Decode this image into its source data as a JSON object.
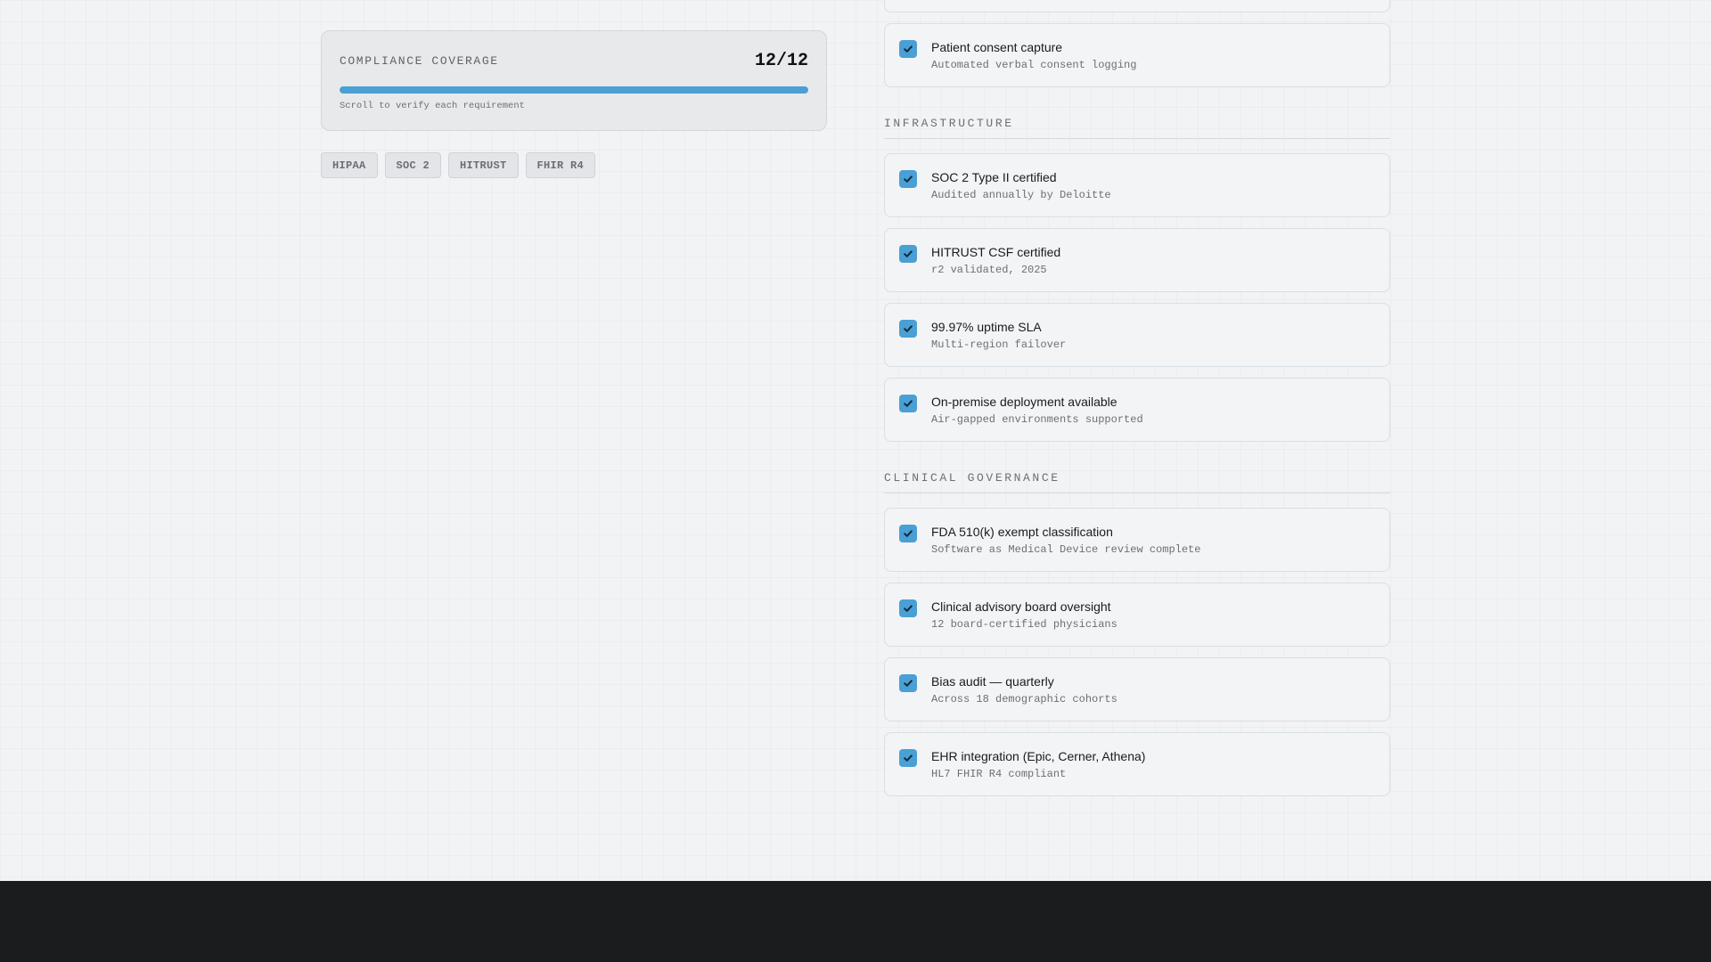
{
  "coverage": {
    "label": "COMPLIANCE COVERAGE",
    "count": "12/12",
    "progress_fraction": 1.0,
    "hint": "Scroll to verify each requirement"
  },
  "badges": [
    "HIPAA",
    "SOC 2",
    "HITRUST",
    "FHIR R4"
  ],
  "items_top": [
    {
      "title": "Patient consent capture",
      "subtitle": "Automated verbal consent logging"
    }
  ],
  "sections": [
    {
      "title": "INFRASTRUCTURE",
      "items": [
        {
          "title": "SOC 2 Type II certified",
          "subtitle": "Audited annually by Deloitte"
        },
        {
          "title": "HITRUST CSF certified",
          "subtitle": "r2 validated, 2025"
        },
        {
          "title": "99.97% uptime SLA",
          "subtitle": "Multi-region failover"
        },
        {
          "title": "On-premise deployment available",
          "subtitle": "Air-gapped environments supported"
        }
      ]
    },
    {
      "title": "CLINICAL GOVERNANCE",
      "items": [
        {
          "title": "FDA 510(k) exempt classification",
          "subtitle": "Software as Medical Device review complete"
        },
        {
          "title": "Clinical advisory board oversight",
          "subtitle": "12 board-certified physicians"
        },
        {
          "title": "Bias audit — quarterly",
          "subtitle": "Across 18 demographic cohorts"
        },
        {
          "title": "EHR integration (Epic, Cerner, Athena)",
          "subtitle": "HL7 FHIR R4 compliant"
        }
      ]
    }
  ],
  "icons": {
    "check": "checkmark-icon"
  },
  "colors": {
    "accent": "#4a9fd4",
    "footer": "#1b1c1e"
  }
}
